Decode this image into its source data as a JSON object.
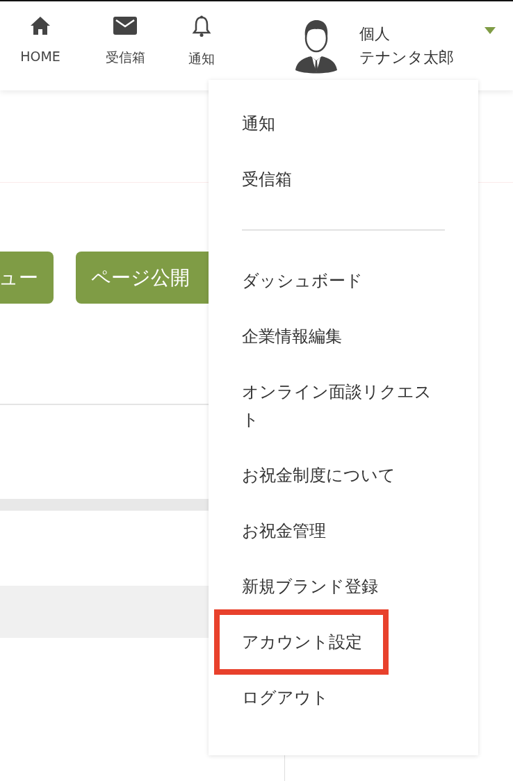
{
  "header": {
    "nav": [
      {
        "label": "HOME",
        "kind": "home"
      },
      {
        "label": "受信箱",
        "kind": "inbox"
      },
      {
        "label": "通知",
        "kind": "bell"
      }
    ],
    "user": {
      "type_label": "個人",
      "name": "テナンタ太郎"
    }
  },
  "page": {
    "buttons": [
      "ュー",
      "ページ公開"
    ]
  },
  "menu": {
    "groups": [
      {
        "items": [
          {
            "label": "通知",
            "highlighted": false
          },
          {
            "label": "受信箱",
            "highlighted": false
          }
        ]
      },
      {
        "items": [
          {
            "label": "ダッシュボード",
            "highlighted": false
          },
          {
            "label": "企業情報編集",
            "highlighted": false
          },
          {
            "label": "オンライン面談リクエスト",
            "highlighted": false
          },
          {
            "label": "お祝金制度について",
            "highlighted": false
          },
          {
            "label": "お祝金管理",
            "highlighted": false
          },
          {
            "label": "新規ブランド登録",
            "highlighted": false
          },
          {
            "label": "アカウント設定",
            "highlighted": true
          },
          {
            "label": "ログアウト",
            "highlighted": false
          }
        ]
      }
    ]
  }
}
